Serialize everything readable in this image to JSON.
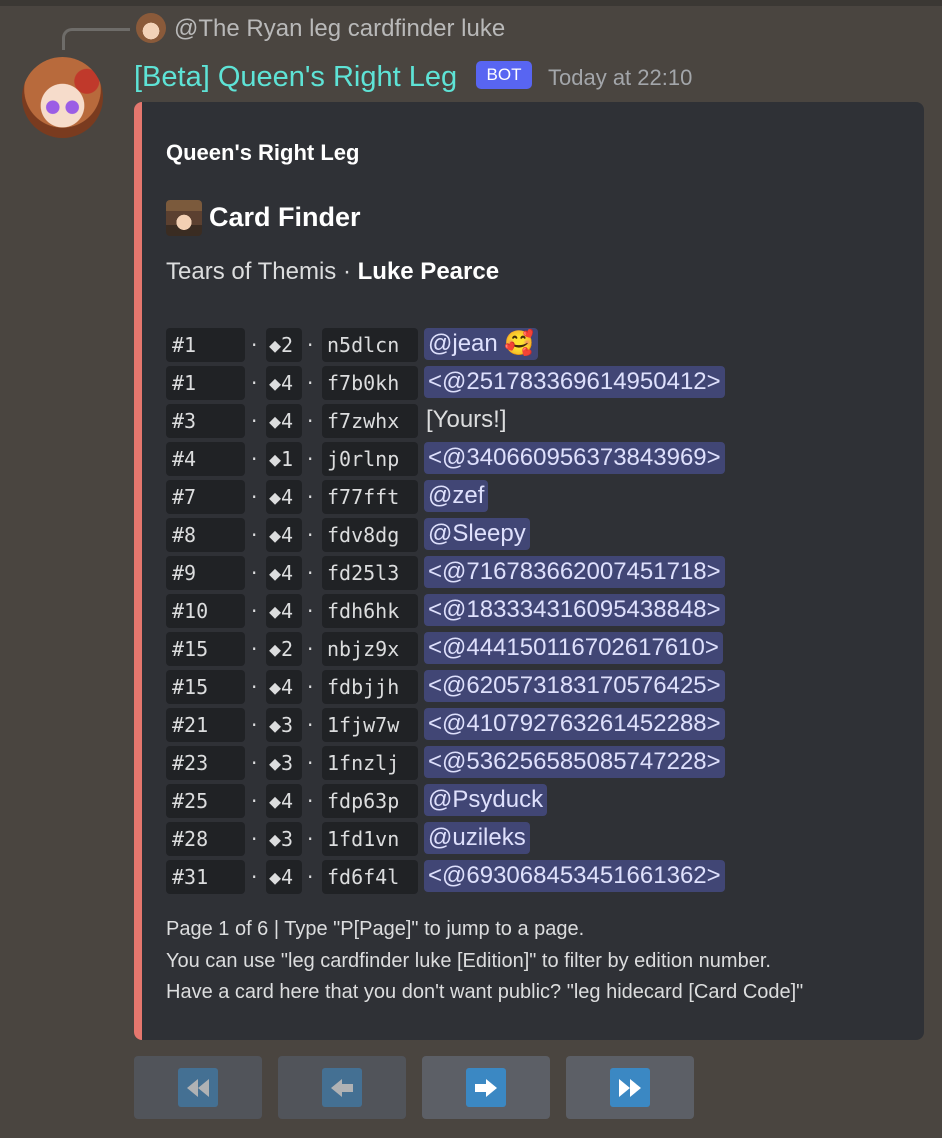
{
  "reply": {
    "text": "@The Ryan leg cardfinder luke"
  },
  "message": {
    "username": "[Beta] Queen's Right Leg",
    "bot_tag": "BOT",
    "timestamp": "Today at 22:10"
  },
  "embed": {
    "accent_color": "#e5776e",
    "author": "Queen's Right Leg",
    "title": "Card Finder",
    "subtitle_prefix": "Tears of Themis · ",
    "subtitle_bold": "Luke Pearce",
    "cards": [
      {
        "number": "#1",
        "stars": "◆2",
        "code": "n5dlcn",
        "owner": "@jean 🥰",
        "owner_type": "mention"
      },
      {
        "number": "#1",
        "stars": "◆4",
        "code": "f7b0kh",
        "owner": "<@251783369614950412>",
        "owner_type": "mention"
      },
      {
        "number": "#3",
        "stars": "◆4",
        "code": "f7zwhx",
        "owner": "[Yours!]",
        "owner_type": "plain"
      },
      {
        "number": "#4",
        "stars": "◆1",
        "code": "j0rlnp",
        "owner": "<@340660956373843969>",
        "owner_type": "mention"
      },
      {
        "number": "#7",
        "stars": "◆4",
        "code": "f77fft",
        "owner": "@zef",
        "owner_type": "mention"
      },
      {
        "number": "#8",
        "stars": "◆4",
        "code": "fdv8dg",
        "owner": "@Sleepy",
        "owner_type": "mention"
      },
      {
        "number": "#9",
        "stars": "◆4",
        "code": "fd25l3",
        "owner": "<@716783662007451718>",
        "owner_type": "mention"
      },
      {
        "number": "#10",
        "stars": "◆4",
        "code": "fdh6hk",
        "owner": "<@183334316095438848>",
        "owner_type": "mention"
      },
      {
        "number": "#15",
        "stars": "◆2",
        "code": "nbjz9x",
        "owner": "<@444150116702617610>",
        "owner_type": "mention"
      },
      {
        "number": "#15",
        "stars": "◆4",
        "code": "fdbjjh",
        "owner": "<@620573183170576425>",
        "owner_type": "mention"
      },
      {
        "number": "#21",
        "stars": "◆3",
        "code": "1fjw7w",
        "owner": "<@410792763261452288>",
        "owner_type": "mention"
      },
      {
        "number": "#23",
        "stars": "◆3",
        "code": "1fnzlj",
        "owner": "<@536256585085747228>",
        "owner_type": "mention"
      },
      {
        "number": "#25",
        "stars": "◆4",
        "code": "fdp63p",
        "owner": "@Psyduck",
        "owner_type": "mention"
      },
      {
        "number": "#28",
        "stars": "◆3",
        "code": "1fd1vn",
        "owner": "@uzileks",
        "owner_type": "mention"
      },
      {
        "number": "#31",
        "stars": "◆4",
        "code": "fd6f4l",
        "owner": "<@693068453451661362>",
        "owner_type": "mention"
      }
    ],
    "footer_lines": [
      "Page 1 of 6 | Type \"P[Page]\" to jump to a page.",
      "You can use \"leg cardfinder luke [Edition]\" to filter by edition number.",
      "Have a card here that you don't want public? \"leg hidecard [Card Code]\""
    ]
  },
  "buttons": [
    {
      "icon": "rewind-icon",
      "disabled": true
    },
    {
      "icon": "left-arrow-icon",
      "disabled": true
    },
    {
      "icon": "right-arrow-icon",
      "disabled": false
    },
    {
      "icon": "fast-forward-icon",
      "disabled": false
    }
  ]
}
